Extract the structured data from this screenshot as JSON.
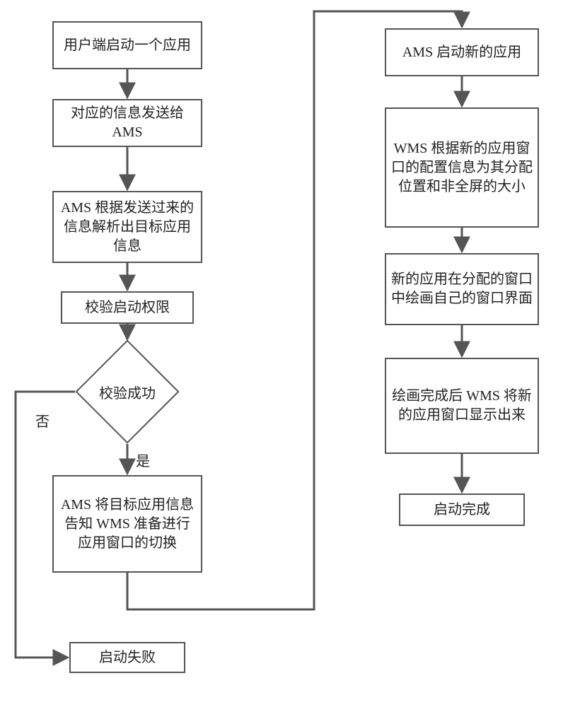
{
  "boxes": {
    "b1": "用户端启动一个应用",
    "b2": "对应的信息发送给 AMS",
    "b3": "AMS 根据发送过来的信息解析出目标应用信息",
    "b4": "校验启动权限",
    "d1": "校验成功",
    "b6": "AMS 将目标应用信息告知 WMS 准备进行应用窗口的切换",
    "b7": "启动失败",
    "b8": "AMS 启动新的应用",
    "b9": "WMS 根据新的应用窗口的配置信息为其分配位置和非全屏的大小",
    "b10": "新的应用在分配的窗口中绘画自己的窗口界面",
    "b11": "绘画完成后 WMS 将新的应用窗口显示出来",
    "b12": "启动完成"
  },
  "labels": {
    "no": "否",
    "yes": "是"
  },
  "colors": {
    "stroke": "#555555",
    "arrow": "#555555"
  }
}
